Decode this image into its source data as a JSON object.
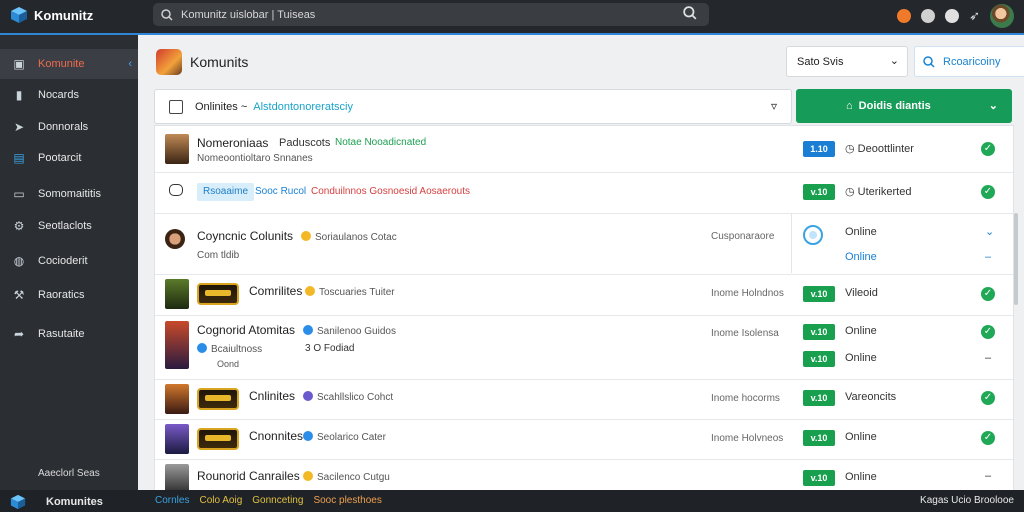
{
  "app": {
    "title": "Komunitz",
    "search_placeholder": "Komunitz uislobar | Tuiseas"
  },
  "sidebar": {
    "items": [
      {
        "label": "Komunite",
        "icon": "home-icon"
      },
      {
        "label": "Nocards",
        "icon": "chart-icon"
      },
      {
        "label": "Donnorals",
        "icon": "send-icon"
      },
      {
        "label": "Pootarcit",
        "icon": "board-icon"
      },
      {
        "label": "Somomaititis",
        "icon": "monitor-icon"
      },
      {
        "label": "Seotlaclots",
        "icon": "gear-icon"
      },
      {
        "label": "Cocioderit",
        "icon": "globe-icon"
      },
      {
        "label": "Raoratics",
        "icon": "wrench-icon"
      },
      {
        "label": "Rasutaite",
        "icon": "forward-icon"
      }
    ],
    "footer": "Aaeclorl Seas"
  },
  "header": {
    "title": "Komunits",
    "dropdown": "Sato Svis",
    "outline_button": "Rcoaricoiny"
  },
  "filter": {
    "label": "Onlinites ~",
    "link": "Alstdontonoreratsciy"
  },
  "primary_action": {
    "label": "Doidis diantis"
  },
  "rows": [
    {
      "name": "Nomeroniaas",
      "extra": "Paduscots",
      "tag": "Notae Nooadicnated",
      "sub": "Nomeoontioltaro Snnanes",
      "version": "1.10",
      "status": "Deoottlinter"
    },
    {
      "tag_blue": "Rsoaaime",
      "tag2": "Sooc Rucol",
      "tag3": "Conduilnnos Gosnoesid Aosaerouts",
      "version": "v.10",
      "status": "Uterikerted"
    },
    {
      "name": "Coyncnic Colunits",
      "badge": "Soriaulanos Cotac",
      "sub": "Com tldib",
      "minor": "Cusponaraore",
      "status_top": "Online",
      "status_bottom": "Online"
    },
    {
      "name": "Comrilites",
      "badge": "Toscuaries Tuiter",
      "minor": "Inome Holndnos",
      "version": "v.10",
      "status": "Vileoid"
    },
    {
      "name": "Cognorid Atomitas",
      "badge": "Sanilenoo Guidos",
      "sub": "Bcaiultnoss",
      "sub2": "3  O Fodiad",
      "sub3": "Oond",
      "minor": "Inome Isolensa",
      "version": "v.10",
      "version2": "v.10",
      "status": "Online",
      "status2": "Online"
    },
    {
      "name": "Cnlinites",
      "badge": "Scahllslico Cohct",
      "minor": "Inome hocorms",
      "version": "v.10",
      "status": "Vareoncits"
    },
    {
      "name": "Cnonnites",
      "badge": "Seolarico Cater",
      "minor": "Inome Holvneos",
      "version": "v.10",
      "status": "Online"
    },
    {
      "name": "Rounorid Canrailes",
      "badge": "Sacilenco Cutgu",
      "version": "v.10",
      "status": "Online"
    }
  ],
  "bottom": {
    "app": "Komunites",
    "links": [
      "Cornles",
      "Colo Aoig",
      "Gonnceting",
      "Sooc plesthoes"
    ],
    "right": "Kagas  Ucio  Broolooe"
  }
}
